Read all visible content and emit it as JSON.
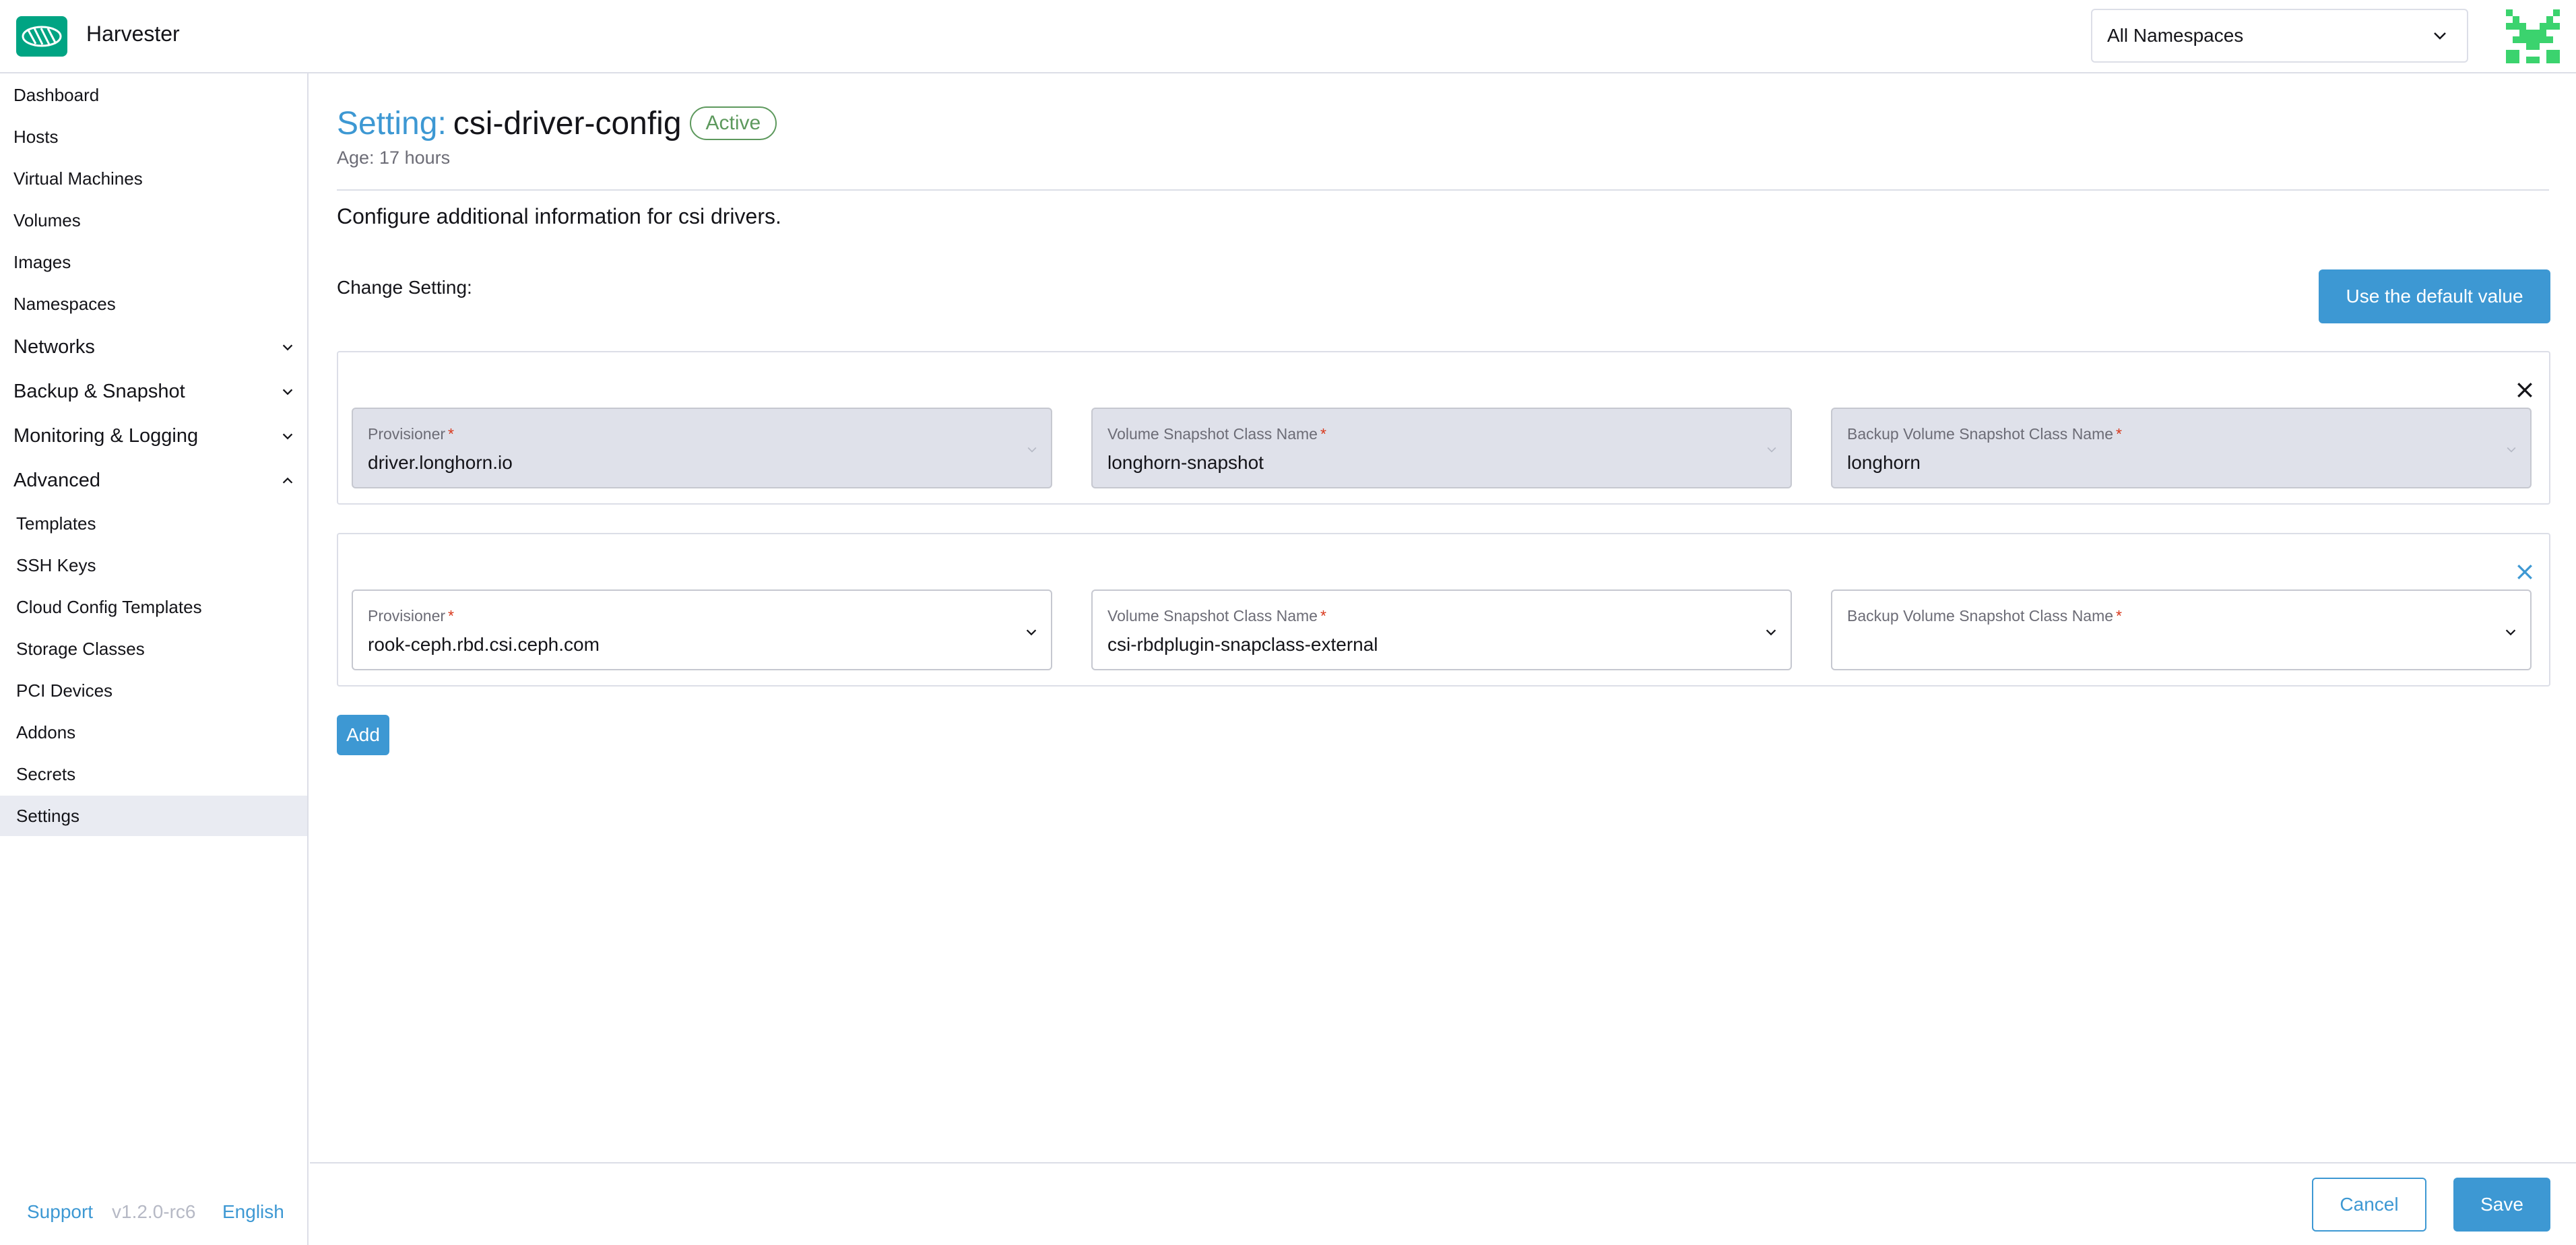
{
  "app": {
    "title": "Harvester"
  },
  "header": {
    "namespace_select": "All Namespaces"
  },
  "sidebar": {
    "items": [
      {
        "label": "Dashboard"
      },
      {
        "label": "Hosts"
      },
      {
        "label": "Virtual Machines"
      },
      {
        "label": "Volumes"
      },
      {
        "label": "Images"
      },
      {
        "label": "Namespaces"
      }
    ],
    "groups": [
      {
        "label": "Networks",
        "expanded": false
      },
      {
        "label": "Backup & Snapshot",
        "expanded": false
      },
      {
        "label": "Monitoring & Logging",
        "expanded": false
      },
      {
        "label": "Advanced",
        "expanded": true
      }
    ],
    "advanced_items": [
      {
        "label": "Templates"
      },
      {
        "label": "SSH Keys"
      },
      {
        "label": "Cloud Config Templates"
      },
      {
        "label": "Storage Classes"
      },
      {
        "label": "PCI Devices"
      },
      {
        "label": "Addons"
      },
      {
        "label": "Secrets"
      },
      {
        "label": "Settings",
        "active": true
      }
    ],
    "footer": {
      "support": "Support",
      "version": "v1.2.0-rc6",
      "language": "English"
    }
  },
  "page": {
    "title_prefix": "Setting:",
    "title": "csi-driver-config",
    "status": "Active",
    "age": "Age: 17 hours",
    "description": "Configure additional information for csi drivers.",
    "change_setting_label": "Change Setting:",
    "default_value_button": "Use the default value",
    "add_button": "Add",
    "cancel_button": "Cancel",
    "save_button": "Save"
  },
  "drivers": [
    {
      "disabled": true,
      "provisioner_label": "Provisioner",
      "provisioner": "driver.longhorn.io",
      "snapshot_class_label": "Volume Snapshot Class Name",
      "snapshot_class": "longhorn-snapshot",
      "backup_class_label": "Backup Volume Snapshot Class Name",
      "backup_class": "longhorn"
    },
    {
      "disabled": false,
      "provisioner_label": "Provisioner",
      "provisioner": "rook-ceph.rbd.csi.ceph.com",
      "snapshot_class_label": "Volume Snapshot Class Name",
      "snapshot_class": "csi-rbdplugin-snapclass-external",
      "backup_class_label": "Backup Volume Snapshot Class Name",
      "backup_class": ""
    }
  ],
  "colors": {
    "accent": "#3d98d3",
    "brand": "#00a483",
    "active_badge": "#5d995d",
    "required": "#d8381c"
  }
}
